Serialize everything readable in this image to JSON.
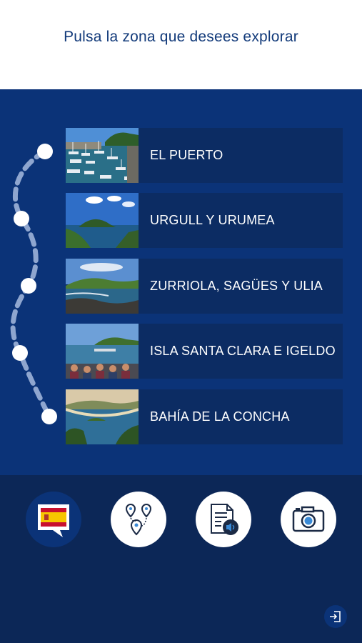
{
  "header": {
    "title": "Pulsa la zona que desees explorar"
  },
  "zones": [
    {
      "label": "EL PUERTO"
    },
    {
      "label": "URGULL Y URUMEA"
    },
    {
      "label": "ZURRIOLA, SAGÜES Y ULIA"
    },
    {
      "label": "ISLA SANTA CLARA E IGELDO"
    },
    {
      "label": "BAHÍA DE LA CONCHA"
    }
  ],
  "toolbar": {
    "items": [
      {
        "icon": "language-flag-icon",
        "active": true
      },
      {
        "icon": "route-map-icon",
        "active": false
      },
      {
        "icon": "audio-document-icon",
        "active": false
      },
      {
        "icon": "camera-icon",
        "active": false
      }
    ]
  },
  "colors": {
    "header_bg": "#ffffff",
    "title_text": "#123a7a",
    "main_bg": "#0b3378",
    "card_bg": "#0c2c63",
    "footer_bg": "#0c2757"
  }
}
